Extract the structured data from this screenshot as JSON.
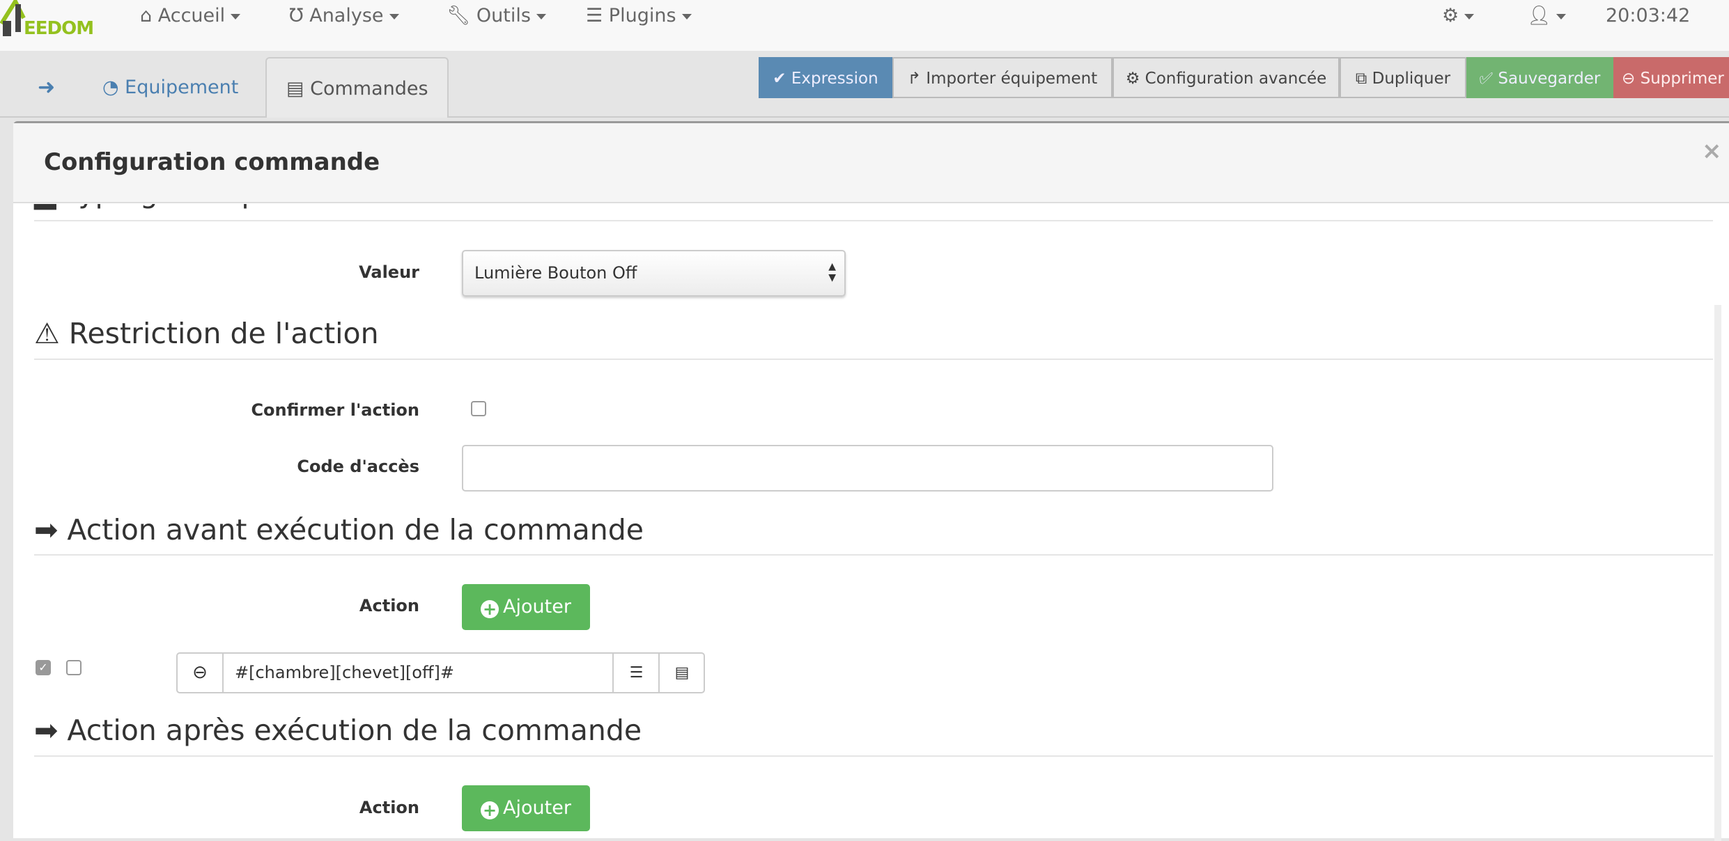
{
  "navbar": {
    "logo_text": "EEDOM",
    "items": [
      {
        "label": "Accueil",
        "icon": "home-icon"
      },
      {
        "label": "Analyse",
        "icon": "stethoscope-icon"
      },
      {
        "label": "Outils",
        "icon": "wrench-icon"
      },
      {
        "label": "Plugins",
        "icon": "tasks-icon"
      }
    ],
    "time": "20:03:42"
  },
  "tabs": {
    "equipement": "Equipement",
    "commandes": "Commandes"
  },
  "toolbar": {
    "expression": "Expression",
    "importer": "Importer équipement",
    "config": "Configuration avancée",
    "dupliquer": "Dupliquer",
    "sauvegarder": "Sauvegarder",
    "supprimer": "Supprimer"
  },
  "colors": {
    "primary": "#5a8ab3",
    "success": "#72b472",
    "danger": "#c96a6a",
    "green_button": "#5cb85c"
  },
  "modal": {
    "title": "Configuration commande",
    "close": "×",
    "type_generique": {
      "heading": "Type générique",
      "label": "Valeur",
      "value": "Lumière Bouton Off"
    },
    "restriction": {
      "heading": "Restriction de l'action",
      "confirm_label": "Confirmer l'action",
      "confirm_checked": false,
      "code_label": "Code d'accès",
      "code_value": ""
    },
    "avant": {
      "heading": "Action avant exécution de la commande",
      "action_label": "Action",
      "add": "Ajouter",
      "rows": [
        {
          "enabled": true,
          "background": false,
          "cmd": "#[chambre][chevet][off]#"
        }
      ]
    },
    "apres": {
      "heading": "Action après exécution de la commande",
      "action_label": "Action",
      "add": "Ajouter"
    }
  }
}
